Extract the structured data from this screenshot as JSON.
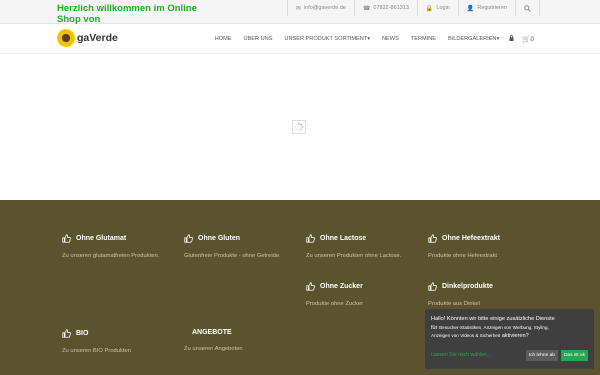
{
  "topbar": {
    "welcome": "Herzlich willkommen im Online Shop von",
    "email": "info@gaverde.de",
    "phone": "07822-861313",
    "login": "Login",
    "register": "Registrieren"
  },
  "header": {
    "logo_text": "gaVerde",
    "nav": [
      {
        "label": "HOME"
      },
      {
        "label": "ÜBER UNS"
      },
      {
        "label": "UNSER PRODUKT SORTIMENT"
      },
      {
        "label": "NEWS"
      },
      {
        "label": "TERMINE"
      },
      {
        "label": "BILDERGALERIEN"
      }
    ],
    "cart_count": "0"
  },
  "features": [
    {
      "title": "Ohne Glutamat",
      "desc": "Zu unseren glutamatfreien Produkten.",
      "icon": "thumbs-up-icon"
    },
    {
      "title": "Ohne Gluten",
      "desc": "Glutenfreie Produkte - ohne Getreide.",
      "icon": "thumbs-up-icon"
    },
    {
      "title": "Ohne Lactose",
      "desc": "Zu unseren Produkten ohne Lactose.",
      "icon": "thumbs-up-icon"
    },
    {
      "title": "Ohne Hefeextrakt",
      "desc": "Produkte ohne Hefeextrakt",
      "icon": "thumbs-up-icon"
    },
    {
      "title": "Ohne Zucker",
      "desc": "Produkte ohne Zucker",
      "icon": "thumbs-up-icon"
    },
    {
      "title": "Dinkelprodukte",
      "desc": "Produkte aus Dinkel",
      "icon": "thumbs-up-icon"
    },
    {
      "title": "BIO",
      "desc": "Zu unseren BIO Produkten",
      "icon": "thumbs-up-icon"
    },
    {
      "title": "ANGEBOTE",
      "desc": "Zu unseren Angeboten",
      "icon": ""
    }
  ],
  "cookie": {
    "line1": "Hallo! Könnten wir bitte einige zusätzliche Dienste",
    "line2_prefix": "für",
    "line2_small": "Besucher-Statistiken, Anzeigen von Werbung, Styling,",
    "line3_small": "Anzeigen von Videos & Sicherheit",
    "line3_suffix": "aktivieren?",
    "more": "Lassen Sie mich wählen...",
    "decline": "Ich lehne ab",
    "accept": "Das ist ok"
  },
  "colors": {
    "welcome_green": "#1db51d",
    "footer_bg": "#5b532d",
    "accept_green": "#2aa551"
  }
}
